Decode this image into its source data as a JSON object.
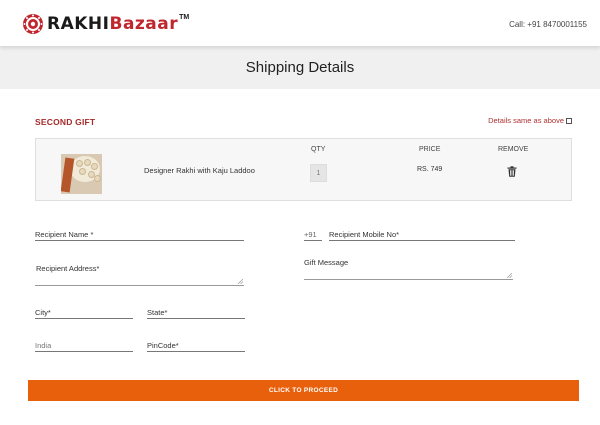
{
  "header": {
    "logo_part1": "RAKHI",
    "logo_part2": "Bazaar",
    "logo_tm": "TM",
    "call_text": "Call: +91 8470001155"
  },
  "banner": {
    "title": "Shipping Details"
  },
  "gift": {
    "section_title": "SECOND GIFT",
    "same_as_above_label": "Details same as above",
    "same_as_above_checked": false,
    "columns": {
      "qty": "QTY",
      "price": "PRICE",
      "remove": "REMOVE"
    },
    "product": {
      "name": "Designer Rakhi with Kaju Laddoo",
      "qty": "1",
      "price": "RS. 749"
    }
  },
  "form": {
    "recipient_name": "Recipient Name *",
    "country_code": "+91",
    "recipient_mobile": "Recipient Mobile No*",
    "recipient_address": "Recipient Address*",
    "gift_message": "Gift Message",
    "city": "City*",
    "state": "State*",
    "country": "India",
    "pincode": "PinCode*"
  },
  "proceed_label": "CLICK TO PROCEED",
  "colors": {
    "accent": "#e8600c",
    "brand_red": "#c0262d",
    "section_title": "#a52a2a"
  }
}
